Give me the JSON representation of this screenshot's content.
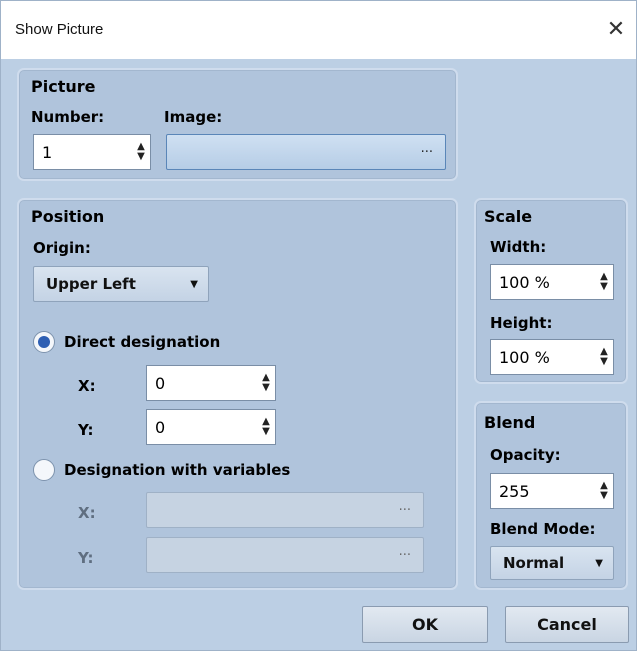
{
  "window": {
    "title": "Show Picture",
    "close_glyph": "✕"
  },
  "picture": {
    "title": "Picture",
    "number_label": "Number:",
    "number_value": "1",
    "image_label": "Image:",
    "image_value": "",
    "browse_glyph": "···"
  },
  "position": {
    "title": "Position",
    "origin_label": "Origin:",
    "origin_value": "Upper Left",
    "direct_label": "Direct designation",
    "direct_selected": true,
    "x_label": "X:",
    "x_value": "0",
    "y_label": "Y:",
    "y_value": "0",
    "variables_label": "Designation with variables",
    "variables_selected": false,
    "var_x_label": "X:",
    "var_y_label": "Y:",
    "browse_glyph": "···"
  },
  "scale": {
    "title": "Scale",
    "width_label": "Width:",
    "width_value": "100 %",
    "height_label": "Height:",
    "height_value": "100 %"
  },
  "blend": {
    "title": "Blend",
    "opacity_label": "Opacity:",
    "opacity_value": "255",
    "mode_label": "Blend Mode:",
    "mode_value": "Normal"
  },
  "buttons": {
    "ok": "OK",
    "cancel": "Cancel"
  },
  "icons": {
    "spin": "spinner-arrows-icon",
    "caret": "chevron-down-icon",
    "close": "close-icon"
  },
  "colors": {
    "accent": "#2e5fb3",
    "dialog_bg": "#bccfe4",
    "panel_bg": "#b0c4dc"
  }
}
